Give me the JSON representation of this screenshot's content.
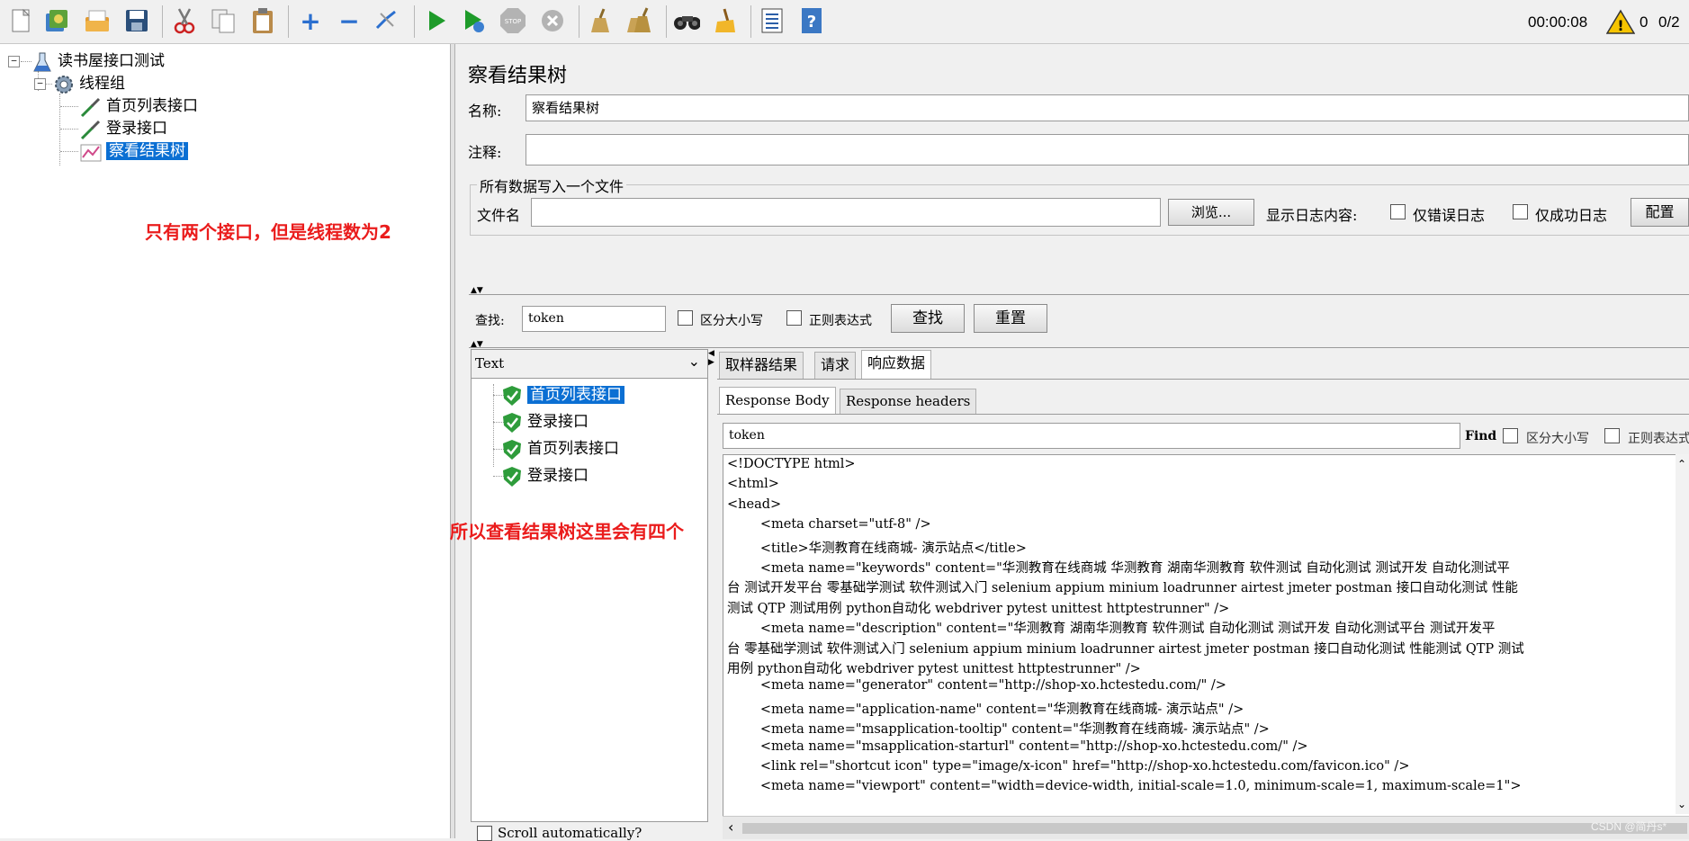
{
  "toolbar": {
    "buttons": [
      "new-icon",
      "templates-icon",
      "open-icon",
      "save-icon",
      "cut-icon",
      "copy-icon",
      "paste-icon",
      "expand-icon",
      "collapse-icon",
      "toggle-icon",
      "start-icon",
      "start-no-pause-icon",
      "stop-icon",
      "shutdown-icon",
      "clear-icon",
      "clear-all-icon",
      "search-icon",
      "reset-search-icon",
      "function-helper-icon",
      "help-icon"
    ],
    "elapsed_time": "00:00:08",
    "warning_count": "0",
    "thread_ratio": "0/2"
  },
  "tree": {
    "test_plan": "读书屋接口测试",
    "thread_group": "线程组",
    "samplers": [
      "首页列表接口",
      "登录接口"
    ],
    "listener": "察看结果树"
  },
  "annotations": {
    "note_left": "只有两个接口，但是线程数为2",
    "note_middle": "所以查看结果树这里会有四个"
  },
  "panel": {
    "title": "察看结果树",
    "name_label": "名称:",
    "name_value": "察看结果树",
    "comment_label": "注释:",
    "comment_value": "",
    "file_group_title": "所有数据写入一个文件",
    "filename_label": "文件名",
    "filename_value": "",
    "browse_button": "浏览...",
    "log_content_label": "显示日志内容:",
    "errors_only_label": "仅错误日志",
    "success_only_label": "仅成功日志",
    "configure_button": "配置"
  },
  "search": {
    "label": "查找:",
    "value": "token",
    "case_sensitive_label": "区分大小写",
    "regex_label": "正则表达式",
    "find_button": "查找",
    "reset_button": "重置"
  },
  "results": {
    "renderer": "Text",
    "items": [
      "首页列表接口",
      "登录接口",
      "首页列表接口",
      "登录接口"
    ],
    "scroll_auto_label": "Scroll automatically?"
  },
  "result_tabs": [
    "取样器结果",
    "请求",
    "响应数据"
  ],
  "response_tabs": [
    "Response Body",
    "Response headers"
  ],
  "response_find": {
    "value": "token",
    "find_label": "Find",
    "case_label": "区分大小写",
    "regex_label": "正则表达式"
  },
  "response_body": [
    "<!DOCTYPE html>",
    "<html>",
    "<head>",
    "        <meta charset=\"utf-8\" />",
    "        <title>华测教育在线商城- 演示站点</title>",
    "        <meta name=\"keywords\" content=\"华测教育在线商城 华测教育 湖南华测教育 软件测试 自动化测试 测试开发 自动化测试平",
    "台 测试开发平台 零基础学测试 软件测试入门 selenium appium minium loadrunner airtest jmeter postman 接口自动化测试 性能",
    "测试 QTP 测试用例 python自动化 webdriver pytest unittest httptestrunner\" />",
    "        <meta name=\"description\" content=\"华测教育 湖南华测教育 软件测试 自动化测试 测试开发 自动化测试平台 测试开发平",
    "台 零基础学测试 软件测试入门 selenium appium minium loadrunner airtest jmeter postman 接口自动化测试 性能测试 QTP 测试",
    "用例 python自动化 webdriver pytest unittest httptestrunner\" />",
    "        <meta name=\"generator\" content=\"http://shop-xo.hctestedu.com/\" />",
    "        <meta name=\"application-name\" content=\"华测教育在线商城- 演示站点\" />",
    "        <meta name=\"msapplication-tooltip\" content=\"华测教育在线商城- 演示站点\" />",
    "        <meta name=\"msapplication-starturl\" content=\"http://shop-xo.hctestedu.com/\" />",
    "        <link rel=\"shortcut icon\" type=\"image/x-icon\" href=\"http://shop-xo.hctestedu.com/favicon.ico\" />",
    "        <meta name=\"viewport\" content=\"width=device-width, initial-scale=1.0, minimum-scale=1, maximum-scale=1\">"
  ],
  "watermark": "CSDN @简丹s*"
}
